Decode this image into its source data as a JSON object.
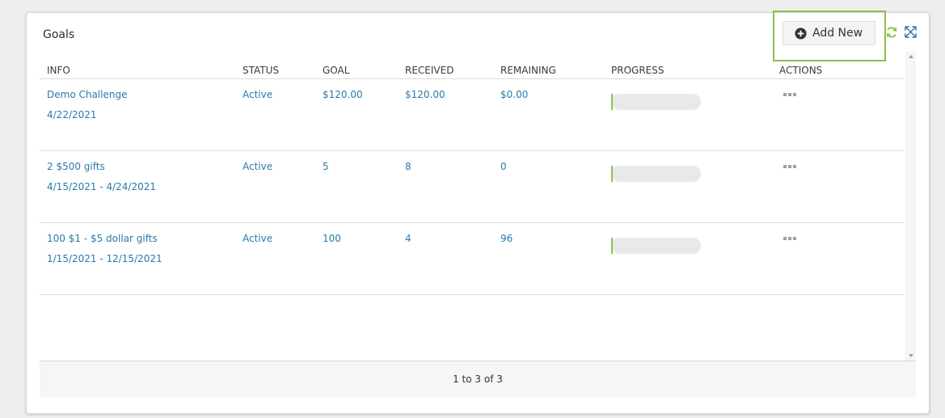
{
  "panel": {
    "title": "Goals",
    "add_label": "Add New"
  },
  "table": {
    "columns": [
      "INFO",
      "STATUS",
      "GOAL",
      "RECEIVED",
      "REMAINING",
      "PROGRESS",
      "ACTIONS"
    ],
    "rows": [
      {
        "name": "Demo Challenge",
        "dates": "4/22/2021",
        "status": "Active",
        "goal": "$120.00",
        "received": "$120.00",
        "remaining": "$0.00",
        "progress": 0
      },
      {
        "name": "2 $500 gifts",
        "dates": "4/15/2021 - 4/24/2021",
        "status": "Active",
        "goal": "5",
        "received": "8",
        "remaining": "0",
        "progress": 0
      },
      {
        "name": "100 $1 - $5 dollar gifts",
        "dates": "1/15/2021 - 12/15/2021",
        "status": "Active",
        "goal": "100",
        "received": "4",
        "remaining": "96",
        "progress": 0
      }
    ]
  },
  "pagination": {
    "label": "1 to 3 of 3"
  },
  "icons": {
    "add": "plus-circle-icon",
    "refresh": "refresh-icon",
    "expand": "expand-icon",
    "actions": "more-dots-icon"
  },
  "colors": {
    "link": "#2a7aab",
    "accent": "#8bc34a"
  }
}
